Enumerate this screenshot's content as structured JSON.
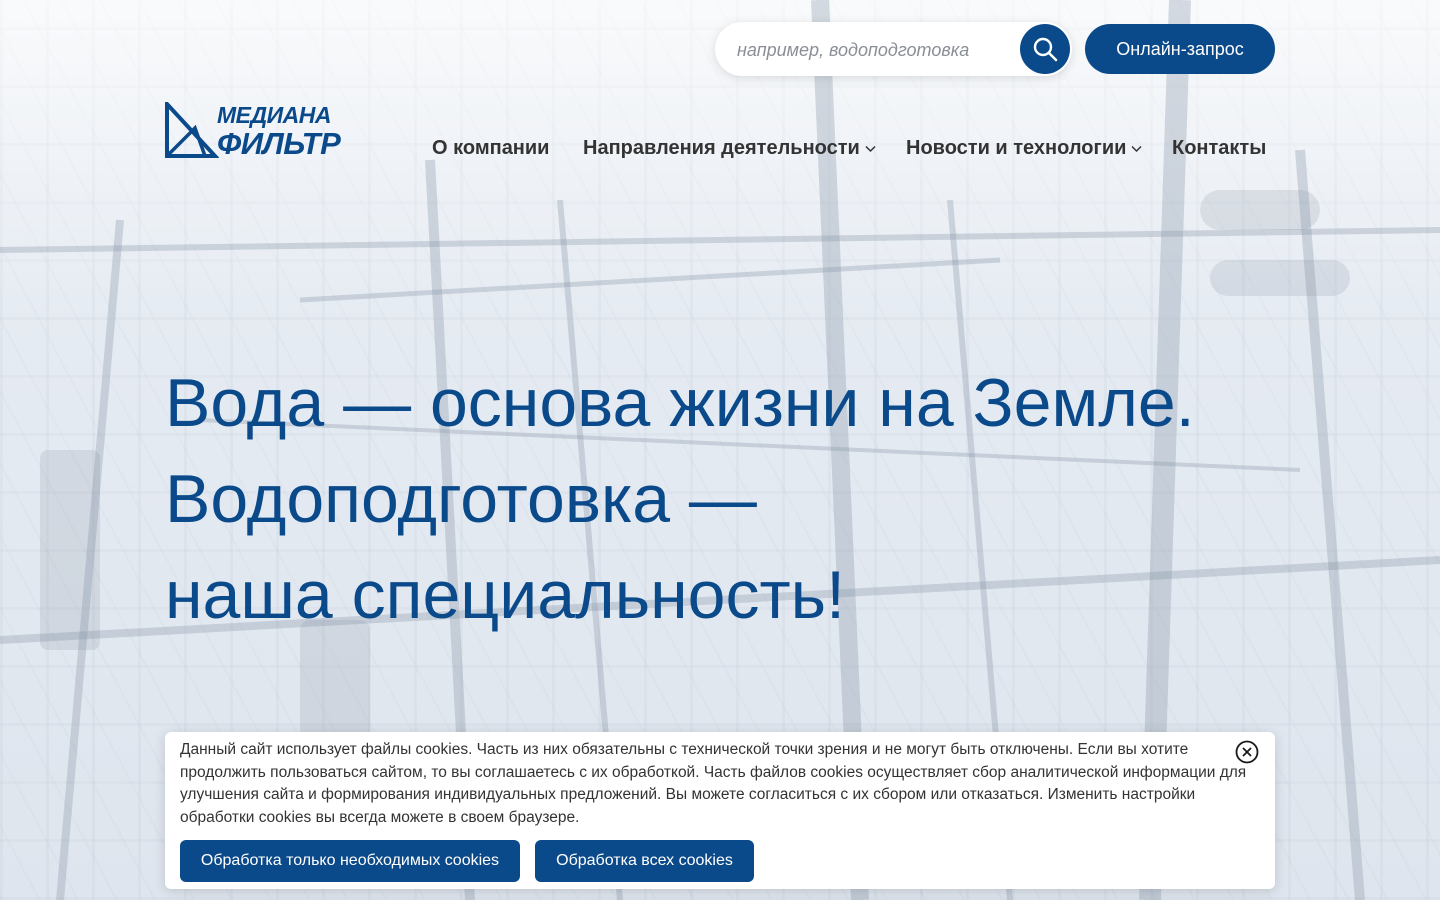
{
  "header": {
    "search": {
      "placeholder": "например, водоподготовка",
      "value": ""
    },
    "online_request_label": "Онлайн-запрос"
  },
  "logo": {
    "line1": "МЕДИАНА",
    "line2": "ФИЛЬТР"
  },
  "nav": {
    "items": [
      {
        "label": "О компании",
        "has_dropdown": false
      },
      {
        "label": "Направления деятельности",
        "has_dropdown": true
      },
      {
        "label": "Новости и технологии",
        "has_dropdown": true
      },
      {
        "label": "Контакты",
        "has_dropdown": false
      }
    ]
  },
  "hero": {
    "line1": "Вода — основа жизни на Земле.",
    "line2": "Водоподготовка —",
    "line3": "наша специальность!"
  },
  "cookie_banner": {
    "text": "Данный сайт использует файлы cookies. Часть из них обязательны с технической точки зрения и не могут быть отключены. Если вы хотите продолжить пользоваться сайтом, то вы соглашаетесь с их обработкой. Часть файлов cookies осуществляет сбор аналитической информации для улучшения сайта и формирования индивидуальных предложений. Вы можете согласиться с их сбором или отказаться. Изменить настройки обработки cookies вы всегда можете в своем браузере.",
    "button_necessary": "Обработка только необходимых cookies",
    "button_all": "Обработка всех cookies"
  },
  "colors": {
    "brand": "#0b4a8a",
    "nav_text": "#333333",
    "background": "#eef2f7"
  },
  "icons": {
    "search": "search-icon",
    "close": "close-circle-icon",
    "dropdown": "chevron-down-icon"
  }
}
